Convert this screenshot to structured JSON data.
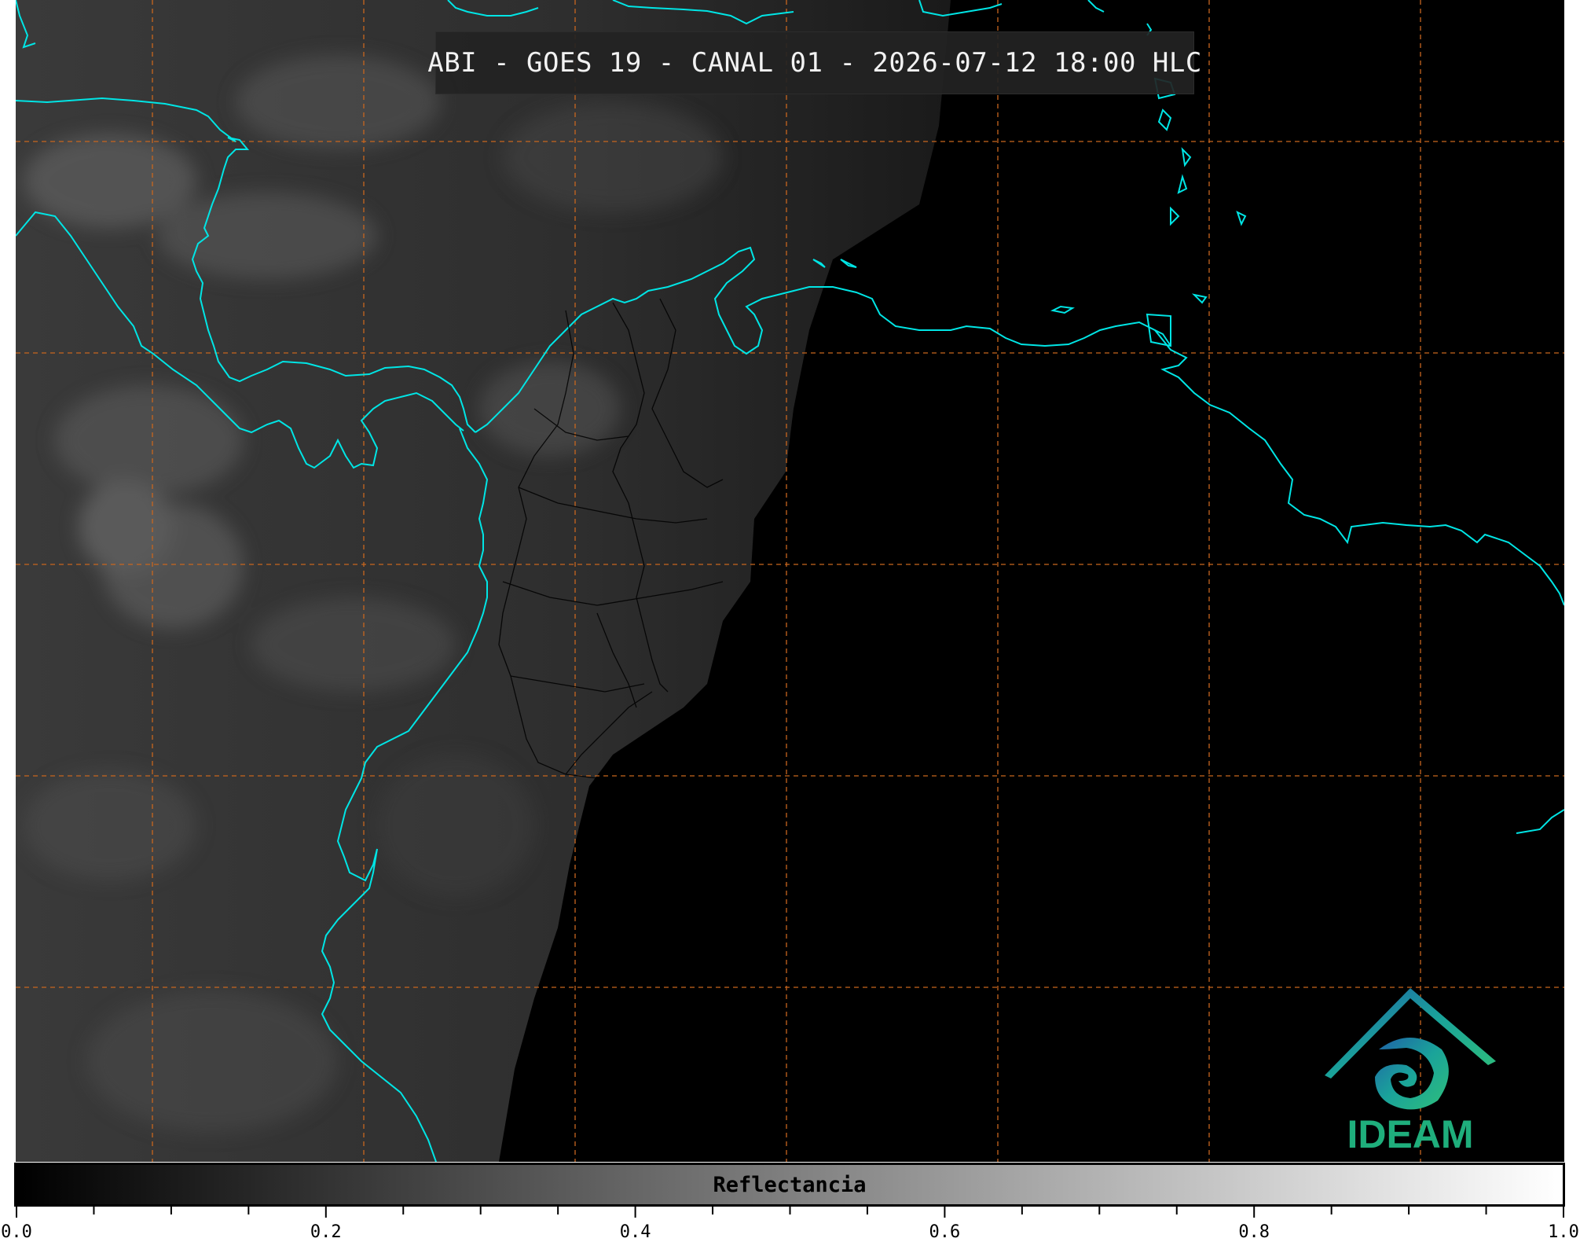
{
  "title": "ABI - GOES 19 - CANAL 01 - 2026-07-12 18:00 HLC",
  "logo": {
    "text": "IDEAM",
    "icon": "ideam-logo-icon"
  },
  "colorbar": {
    "label": "Reflectancia",
    "min": 0.0,
    "max": 1.0,
    "ticks": [
      "0.0",
      "0.2",
      "0.4",
      "0.6",
      "0.8",
      "1.0"
    ],
    "minor_tick_step": 0.05
  },
  "colors": {
    "coastline": "#00e5e5",
    "grid": "#d2691e",
    "borders": "#000000",
    "logo_gradient": [
      "#1f5fa8",
      "#1aa39a",
      "#2fbf7a"
    ]
  }
}
